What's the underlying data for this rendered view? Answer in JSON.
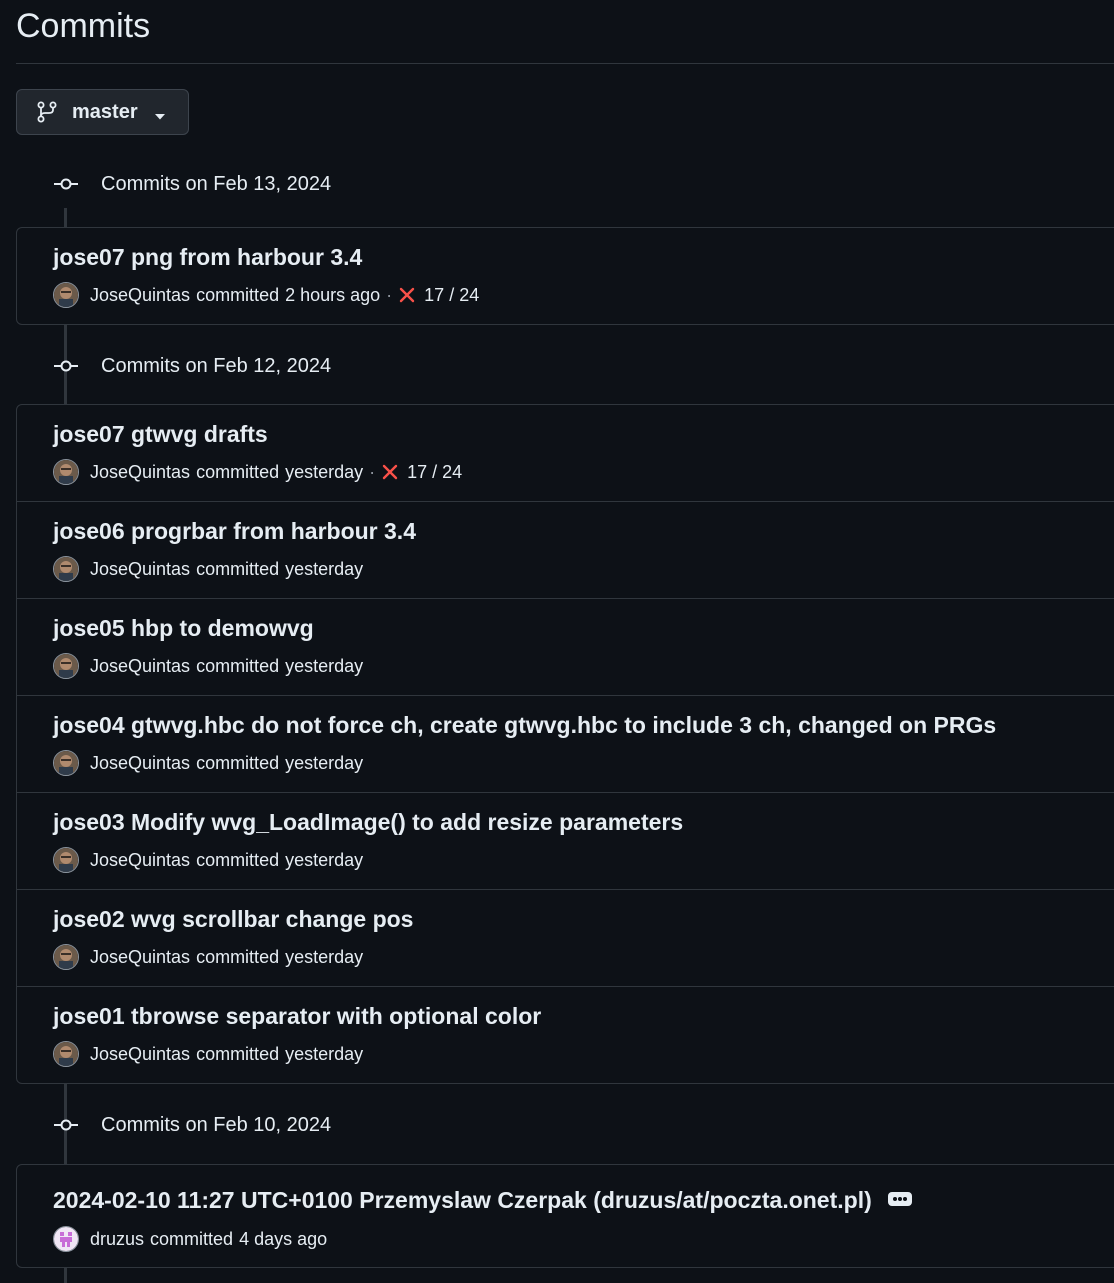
{
  "page": {
    "title": "Commits"
  },
  "branch": {
    "label": "master",
    "icon": "git-branch-icon"
  },
  "colors": {
    "background": "#0d1117",
    "border": "#30363d",
    "text": "#e6edf3",
    "muted": "#9198a1",
    "failure": "#f85149"
  },
  "groups": [
    {
      "label": "Commits on Feb 13, 2024",
      "commits": [
        {
          "title": "jose07 png from harbour 3.4",
          "author": "JoseQuintas",
          "action": "committed",
          "time": "2 hours ago",
          "status": "failure",
          "checks": "17 / 24"
        }
      ]
    },
    {
      "label": "Commits on Feb 12, 2024",
      "commits": [
        {
          "title": "jose07 gtwvg drafts",
          "author": "JoseQuintas",
          "action": "committed",
          "time": "yesterday",
          "status": "failure",
          "checks": "17 / 24"
        },
        {
          "title": "jose06 progrbar from harbour 3.4",
          "author": "JoseQuintas",
          "action": "committed",
          "time": "yesterday"
        },
        {
          "title": "jose05 hbp to demowvg",
          "author": "JoseQuintas",
          "action": "committed",
          "time": "yesterday"
        },
        {
          "title": "jose04 gtwvg.hbc do not force ch, create gtwvg.hbc to include 3 ch, changed on PRGs",
          "author": "JoseQuintas",
          "action": "committed",
          "time": "yesterday"
        },
        {
          "title": "jose03 Modify wvg_LoadImage() to add resize parameters",
          "author": "JoseQuintas",
          "action": "committed",
          "time": "yesterday"
        },
        {
          "title": "jose02 wvg scrollbar change pos",
          "author": "JoseQuintas",
          "action": "committed",
          "time": "yesterday"
        },
        {
          "title": "jose01 tbrowse separator with optional color",
          "author": "JoseQuintas",
          "action": "committed",
          "time": "yesterday"
        }
      ]
    },
    {
      "label": "Commits on Feb 10, 2024",
      "commits": [
        {
          "title": "2024-02-10 11:27 UTC+0100 Przemyslaw Czerpak (druzus/at/poczta.onet.pl)",
          "author": "druzus",
          "action": "committed",
          "time": "4 days ago",
          "has_more": true
        }
      ]
    }
  ]
}
